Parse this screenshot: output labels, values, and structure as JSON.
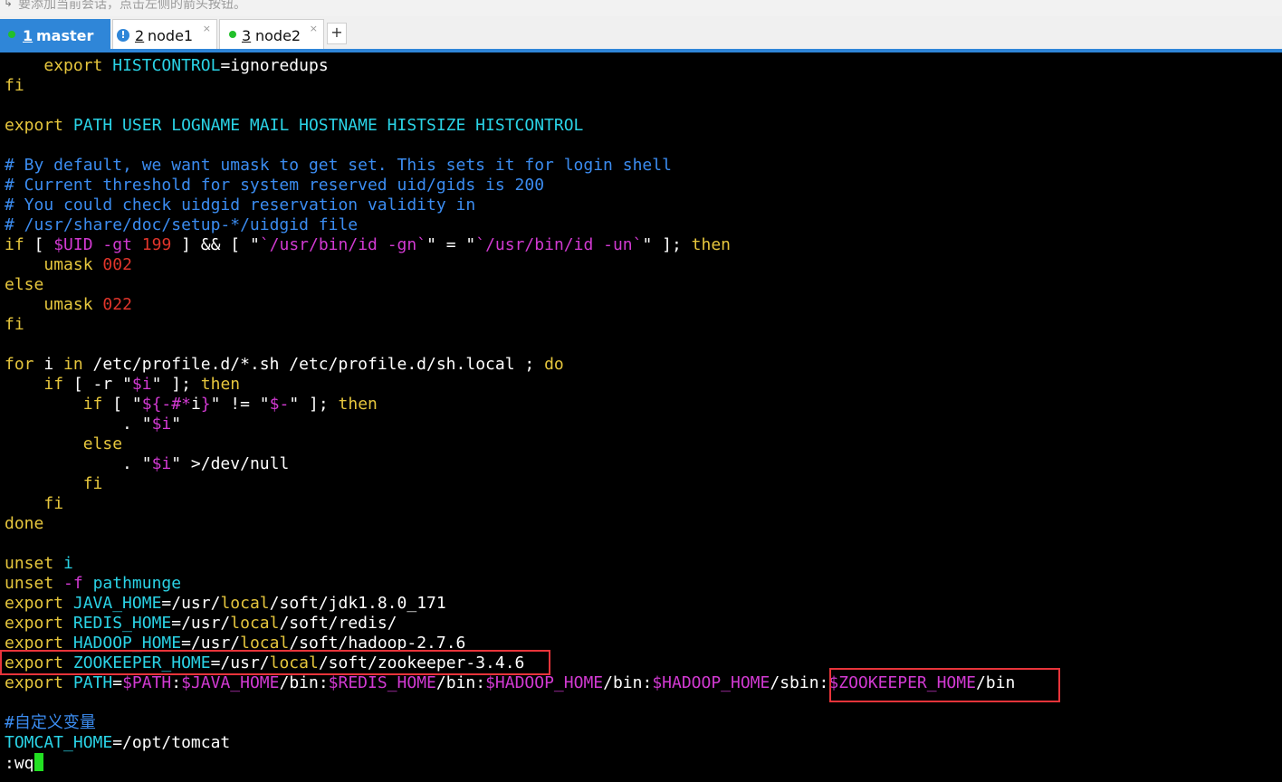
{
  "top_hint": "要添加当前会话，点击左侧的箭头按钮。",
  "tabs": [
    {
      "number": "1",
      "name": "master",
      "icon": "green-dot-icon",
      "active": true
    },
    {
      "number": "2",
      "name": "node1",
      "icon": "info-icon",
      "active": false
    },
    {
      "number": "3",
      "name": "node2",
      "icon": "green-dot-icon",
      "active": false
    }
  ],
  "new_tab_label": "+",
  "colors": {
    "tab_active": "#2f86d8",
    "keyword": "#e6c63d",
    "variable": "#2ad3e6",
    "comment": "#3b8cf0",
    "number": "#e0352b",
    "string": "#d23ad2",
    "cursor": "#22e022",
    "highlight_box": "#e8343a"
  },
  "terminal": {
    "command_line": ":wq",
    "lines": [
      [
        [
          "    ",
          "d"
        ],
        [
          "export",
          "k"
        ],
        [
          " ",
          "d"
        ],
        [
          "HISTCONTROL",
          "v"
        ],
        [
          "=ignoredups",
          "d"
        ]
      ],
      [
        [
          "fi",
          "k"
        ]
      ],
      [],
      [
        [
          "export",
          "k"
        ],
        [
          " PATH USER LOGNAME MAIL HOSTNAME HISTSIZE HISTCONTROL",
          "v"
        ]
      ],
      [],
      [
        [
          "# By default, we want umask to get set. This sets it for login shell",
          "c"
        ]
      ],
      [
        [
          "# Current threshold for system reserved uid/gids is 200",
          "c"
        ]
      ],
      [
        [
          "# You could check uidgid reservation validity in",
          "c"
        ]
      ],
      [
        [
          "# /usr/share/doc/setup-*/uidgid file",
          "c"
        ]
      ],
      [
        [
          "if",
          "k"
        ],
        [
          " [ ",
          "d"
        ],
        [
          "$UID",
          "s"
        ],
        [
          " ",
          "d"
        ],
        [
          "-gt",
          "s"
        ],
        [
          " ",
          "d"
        ],
        [
          "199",
          "n"
        ],
        [
          " ] && [ \"",
          "d"
        ],
        [
          "`/usr/bin/id -gn`",
          "s"
        ],
        [
          "\" = \"",
          "d"
        ],
        [
          "`/usr/bin/id -un`",
          "s"
        ],
        [
          "\" ]; ",
          "d"
        ],
        [
          "then",
          "k"
        ]
      ],
      [
        [
          "    ",
          "d"
        ],
        [
          "umask",
          "k"
        ],
        [
          " ",
          "d"
        ],
        [
          "002",
          "n"
        ]
      ],
      [
        [
          "else",
          "k"
        ]
      ],
      [
        [
          "    ",
          "d"
        ],
        [
          "umask",
          "k"
        ],
        [
          " ",
          "d"
        ],
        [
          "022",
          "n"
        ]
      ],
      [
        [
          "fi",
          "k"
        ]
      ],
      [],
      [
        [
          "for",
          "k"
        ],
        [
          " i ",
          "d"
        ],
        [
          "in",
          "k"
        ],
        [
          " /etc/profile.d/*.sh /etc/profile.d/sh.local ; ",
          "d"
        ],
        [
          "do",
          "k"
        ]
      ],
      [
        [
          "    ",
          "d"
        ],
        [
          "if",
          "k"
        ],
        [
          " [ -r \"",
          "d"
        ],
        [
          "$i",
          "s"
        ],
        [
          "\" ]; ",
          "d"
        ],
        [
          "then",
          "k"
        ]
      ],
      [
        [
          "        ",
          "d"
        ],
        [
          "if",
          "k"
        ],
        [
          " [ \"",
          "d"
        ],
        [
          "${-#*",
          "s"
        ],
        [
          "i",
          "d"
        ],
        [
          "}",
          "s"
        ],
        [
          "\" != \"",
          "d"
        ],
        [
          "$-",
          "s"
        ],
        [
          "\" ]; ",
          "d"
        ],
        [
          "then",
          "k"
        ]
      ],
      [
        [
          "            . \"",
          "d"
        ],
        [
          "$i",
          "s"
        ],
        [
          "\"",
          "d"
        ]
      ],
      [
        [
          "        ",
          "d"
        ],
        [
          "else",
          "k"
        ]
      ],
      [
        [
          "            . \"",
          "d"
        ],
        [
          "$i",
          "s"
        ],
        [
          "\" >/dev/null",
          "d"
        ]
      ],
      [
        [
          "        ",
          "d"
        ],
        [
          "fi",
          "k"
        ]
      ],
      [
        [
          "    ",
          "d"
        ],
        [
          "fi",
          "k"
        ]
      ],
      [
        [
          "done",
          "k"
        ]
      ],
      [],
      [
        [
          "unset",
          "k"
        ],
        [
          " ",
          "d"
        ],
        [
          "i",
          "v"
        ]
      ],
      [
        [
          "unset",
          "k"
        ],
        [
          " ",
          "d"
        ],
        [
          "-f",
          "s"
        ],
        [
          " ",
          "d"
        ],
        [
          "pathmunge",
          "v"
        ]
      ],
      [
        [
          "export",
          "k"
        ],
        [
          " ",
          "d"
        ],
        [
          "JAVA_HOME",
          "v"
        ],
        [
          "=/usr/",
          "d"
        ],
        [
          "local",
          "k"
        ],
        [
          "/soft/jdk1.8.0_171",
          "d"
        ]
      ],
      [
        [
          "export",
          "k"
        ],
        [
          " ",
          "d"
        ],
        [
          "REDIS_HOME",
          "v"
        ],
        [
          "=/usr/",
          "d"
        ],
        [
          "local",
          "k"
        ],
        [
          "/soft/redis/",
          "d"
        ]
      ],
      [
        [
          "export",
          "k"
        ],
        [
          " ",
          "d"
        ],
        [
          "HADOOP_HOME",
          "v"
        ],
        [
          "=/usr/",
          "d"
        ],
        [
          "local",
          "k"
        ],
        [
          "/soft/hadoop-2.7.6",
          "d"
        ]
      ],
      [
        [
          "export",
          "k"
        ],
        [
          " ",
          "d"
        ],
        [
          "ZOOKEEPER_HOME",
          "v"
        ],
        [
          "=/usr/",
          "d"
        ],
        [
          "local",
          "k"
        ],
        [
          "/soft/zookeeper-3.4.6",
          "d"
        ]
      ],
      [
        [
          "export",
          "k"
        ],
        [
          " ",
          "d"
        ],
        [
          "PATH",
          "v"
        ],
        [
          "=",
          "d"
        ],
        [
          "$PATH",
          "s"
        ],
        [
          ":",
          "d"
        ],
        [
          "$JAVA_HOME",
          "s"
        ],
        [
          "/bin:",
          "d"
        ],
        [
          "$REDIS_HOME",
          "s"
        ],
        [
          "/bin:",
          "d"
        ],
        [
          "$HADOOP_HOME",
          "s"
        ],
        [
          "/bin:",
          "d"
        ],
        [
          "$HADOOP_HOME",
          "s"
        ],
        [
          "/sbin:",
          "d"
        ],
        [
          "$ZOOKEEPER_HOME",
          "s"
        ],
        [
          "/bin",
          "d"
        ]
      ],
      [],
      [
        [
          "#自定义变量",
          "c"
        ]
      ],
      [
        [
          "TOMCAT_HOME",
          "v"
        ],
        [
          "=/opt/tomcat",
          "d"
        ]
      ]
    ]
  }
}
